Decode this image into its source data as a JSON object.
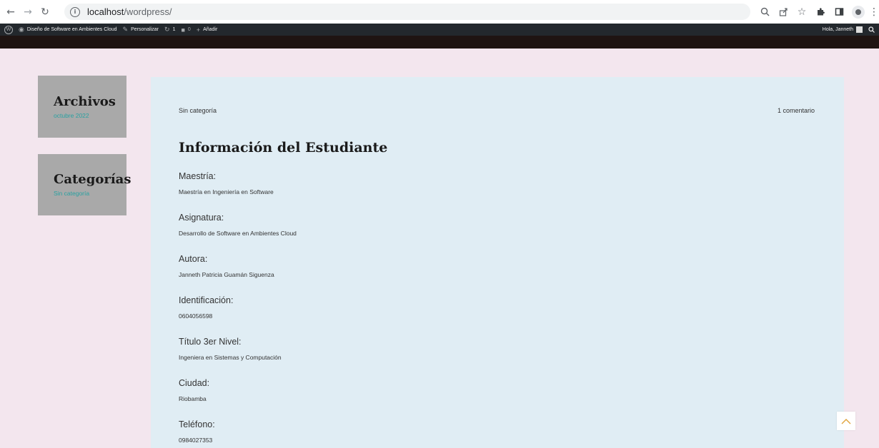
{
  "browser": {
    "url_host": "localhost",
    "url_path": "/wordpress/"
  },
  "adminbar": {
    "site_name": "Diseño de Software en Ambientes Cloud",
    "customize": "Personalizar",
    "updates_count": "1",
    "comments_count": "0",
    "add_new": "Añadir",
    "greeting": "Hola, Janneth"
  },
  "sidebar": {
    "archives_title": "Archivos",
    "archives_link": "octubre 2022",
    "categories_title": "Categorías",
    "categories_link": "Sin categoría"
  },
  "post": {
    "category": "Sin categoría",
    "comments": "1 comentario",
    "title": "Información del Estudiante",
    "fields": [
      {
        "label": "Maestría:",
        "value": "Maestría en Ingeniería en Software"
      },
      {
        "label": "Asignatura:",
        "value": "Desarrollo de Software en Ambientes Cloud"
      },
      {
        "label": "Autora:",
        "value": "Janneth Patricia Guamán Siguenza"
      },
      {
        "label": "Identificación:",
        "value": "0604056598"
      },
      {
        "label": "Título 3er Nivel:",
        "value": "Ingeniera en Sistemas y Computación"
      },
      {
        "label": "Ciudad:",
        "value": "Riobamba"
      },
      {
        "label": "Teléfono:",
        "value": "0984027353"
      }
    ]
  },
  "icons": {
    "back": "arrow-left-icon",
    "forward": "arrow-right-icon",
    "reload": "reload-icon",
    "scroll_top": "chevron-up-icon"
  }
}
